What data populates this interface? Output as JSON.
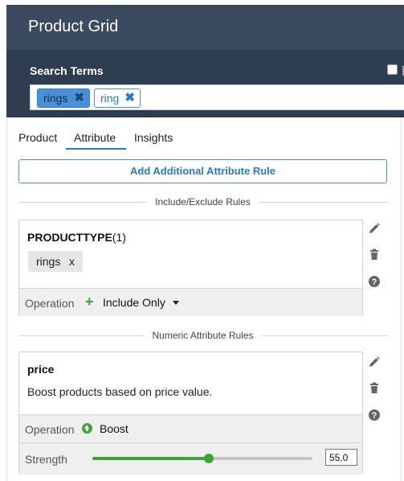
{
  "header": {
    "title": "Product Grid",
    "search_label": "Search Terms",
    "tags": [
      {
        "label": "rings",
        "remove": "✖"
      },
      {
        "label": "ring",
        "remove": "✖"
      }
    ]
  },
  "tabs": [
    {
      "label": "Product",
      "active": false
    },
    {
      "label": "Attribute",
      "active": true
    },
    {
      "label": "Insights",
      "active": false
    }
  ],
  "add_rule_label": "Add Additional Attribute Rule",
  "sections": {
    "include_exclude": "Include/Exclude Rules",
    "numeric": "Numeric Attribute Rules"
  },
  "rule1": {
    "attribute": "PRODUCTTYPE",
    "count": "(1)",
    "value_chip": {
      "label": "rings",
      "remove": "x"
    },
    "operation_label": "Operation",
    "operation_value": "Include Only"
  },
  "rule2": {
    "attribute": "price",
    "description": "Boost products based on price value.",
    "operation_label": "Operation",
    "operation_value": "Boost",
    "strength_label": "Strength",
    "strength_value": "55.0",
    "strength_fraction": 0.53
  },
  "icons": {
    "edit": "pencil-icon",
    "delete": "trash-icon",
    "help": "question-circle-icon",
    "include": "plus-icon",
    "boost": "arrow-up-circle-icon"
  },
  "colors": {
    "header_bg": "#3b4a5e",
    "header_sub_bg": "#2f3d50",
    "accent": "#4a90d6",
    "green": "#3ba535"
  }
}
